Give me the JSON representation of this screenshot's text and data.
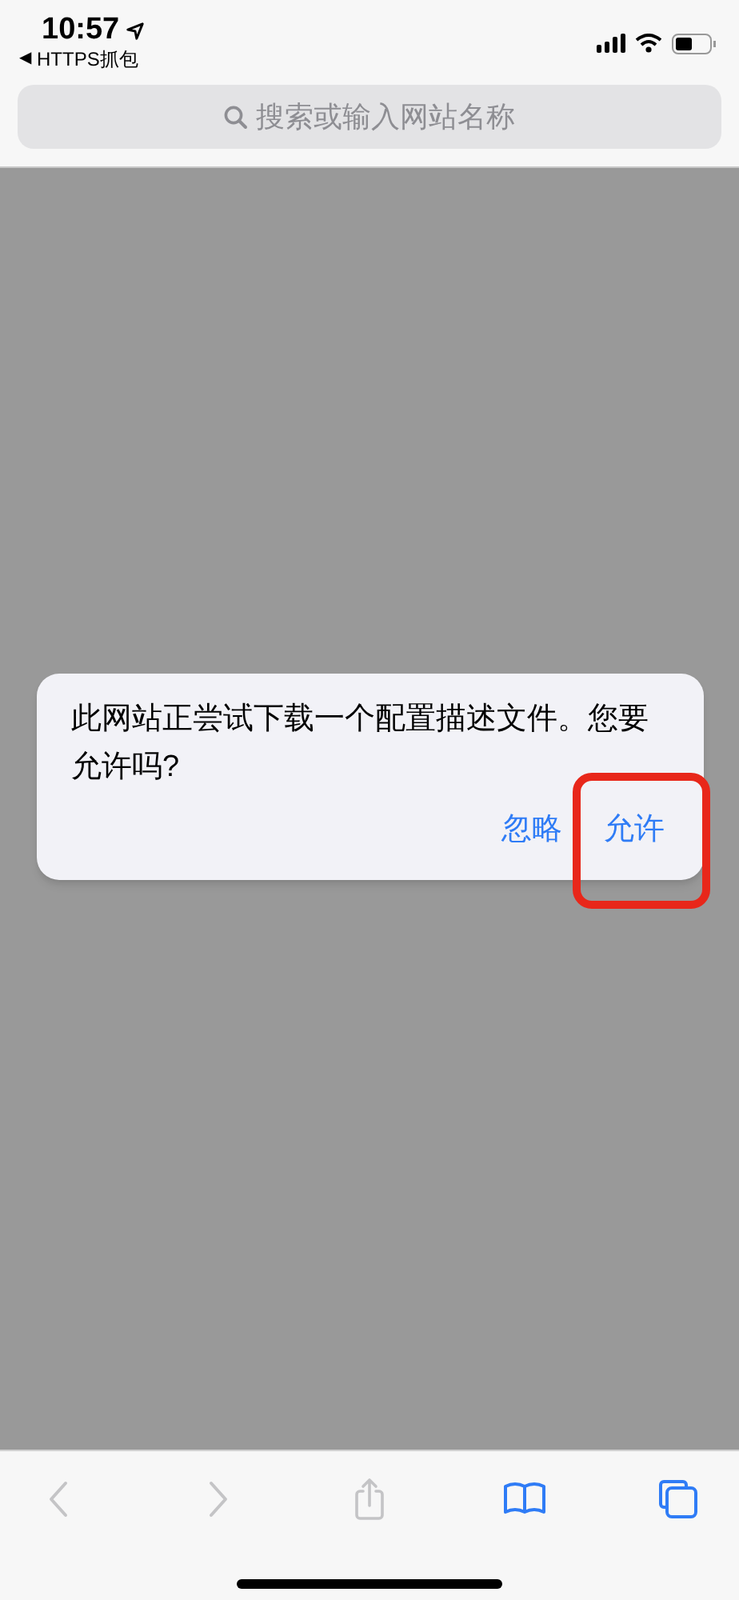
{
  "status_bar": {
    "time": "10:57",
    "back_arrow": "◀",
    "back_app": "HTTPS抓包"
  },
  "address_bar": {
    "placeholder": "搜索或输入网站名称"
  },
  "dialog": {
    "message": "此网站正尝试下载一个配置描述文件。您要允许吗?",
    "buttons": [
      {
        "label": "忽略",
        "highlighted": false
      },
      {
        "label": "允许",
        "highlighted": true
      }
    ]
  },
  "toolbar": [
    {
      "kind": "back",
      "enabled": false
    },
    {
      "kind": "forward",
      "enabled": false
    },
    {
      "kind": "share",
      "enabled": false
    },
    {
      "kind": "bookmarks",
      "enabled": true
    },
    {
      "kind": "tabs",
      "enabled": true
    }
  ]
}
